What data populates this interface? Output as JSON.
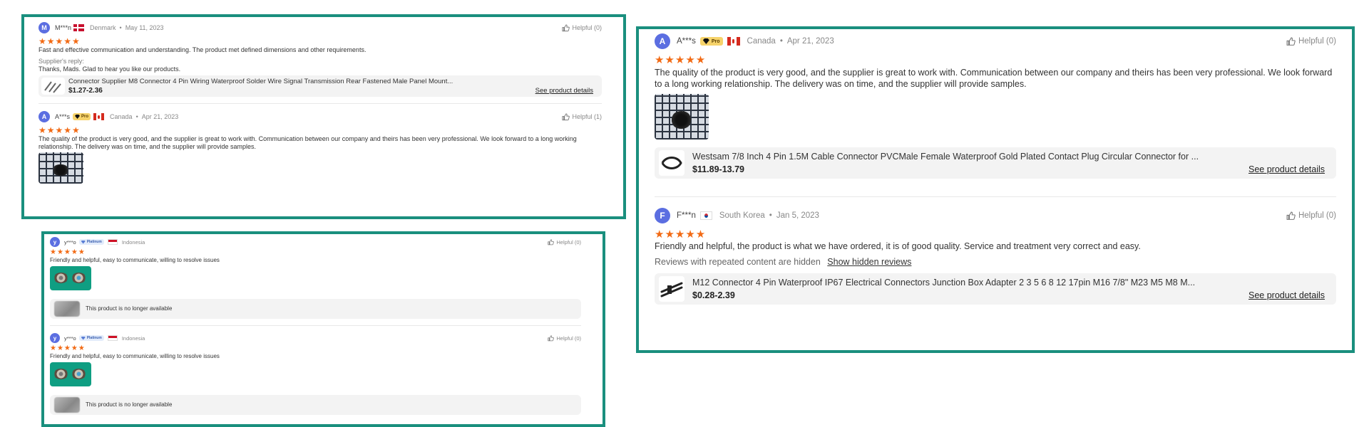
{
  "panel1": {
    "review1": {
      "avatar": "M",
      "name": "M***n",
      "country": "Denmark",
      "date": "May 11, 2023",
      "helpful": "Helpful (0)",
      "stars": "★★★★★",
      "text": "Fast and effective communication and understanding. The product met defined dimensions and other requirements.",
      "reply_label": "Supplier's reply:",
      "reply_text": "Thanks, Mads. Glad to hear you like our products.",
      "product": {
        "title": "Connector Supplier M8 Connector 4 Pin Wiring Waterproof Solder Wire Signal Transmission Rear Fastened Male Panel Mount...",
        "price": "$1.27-2.36",
        "link": "See product details"
      }
    },
    "review2": {
      "avatar": "A",
      "name": "A***s",
      "badge": "Pro",
      "country": "Canada",
      "date": "Apr 21, 2023",
      "helpful": "Helpful (1)",
      "stars": "★★★★★",
      "text": "The quality of the product is very good, and the supplier is great to work with. Communication between our company and theirs has been very professional. We look forward to a long working relationship. The delivery was on time, and the supplier will provide samples."
    }
  },
  "panel2": {
    "review1": {
      "avatar": "y",
      "name": "y***o",
      "badge": "Platinum",
      "country": "Indonesia",
      "helpful": "Helpful (0)",
      "stars": "★★★★★",
      "text": "Friendly and helpful, easy to communicate, willing to resolve issues",
      "unavailable": "This product is no longer available"
    },
    "review2": {
      "avatar": "y",
      "name": "y***o",
      "badge": "Platinum",
      "country": "Indonesia",
      "helpful": "Helpful (0)",
      "stars": "★★★★★",
      "text": "Friendly and helpful, easy to communicate, willing to resolve issues",
      "unavailable": "This product is no longer available"
    }
  },
  "panel3": {
    "review1": {
      "avatar": "A",
      "name": "A***s",
      "badge": "Pro",
      "country": "Canada",
      "date": "Apr 21, 2023",
      "helpful": "Helpful (0)",
      "stars": "★★★★★",
      "text": "The quality of the product is very good, and the supplier is great to work with. Communication between our company and theirs has been very professional. We look forward to a long working relationship. The delivery was on time, and the supplier will provide samples.",
      "product": {
        "title": "Westsam 7/8 Inch 4 Pin 1.5M Cable Connector PVCMale Female Waterproof Gold Plated Contact Plug Circular Connector for ...",
        "price": "$11.89-13.79",
        "link": "See product details"
      }
    },
    "review2": {
      "avatar": "F",
      "name": "F***n",
      "country": "South Korea",
      "date": "Jan 5, 2023",
      "helpful": "Helpful (0)",
      "stars": "★★★★★",
      "text": "Friendly and helpful, the product is what we have ordered, it is of good quality. Service and treatment very correct and easy.",
      "hidden_note": "Reviews with repeated content are hidden",
      "hidden_link": "Show hidden reviews",
      "product": {
        "title": "M12 Connector 4 Pin Waterproof IP67 Electrical Connectors Junction Box Adapter 2 3 5 6 8 12 17pin M16 7/8\" M23 M5 M8 M...",
        "price": "$0.28-2.39",
        "link": "See product details"
      }
    }
  },
  "meta_sep": "•",
  "icons": {
    "thumbs_up": "thumbs-up-icon",
    "diamond": "diamond-icon"
  },
  "colors": {
    "border": "#1a8f7e",
    "stars": "#f26a14",
    "avatar": "#5b6ee1"
  }
}
